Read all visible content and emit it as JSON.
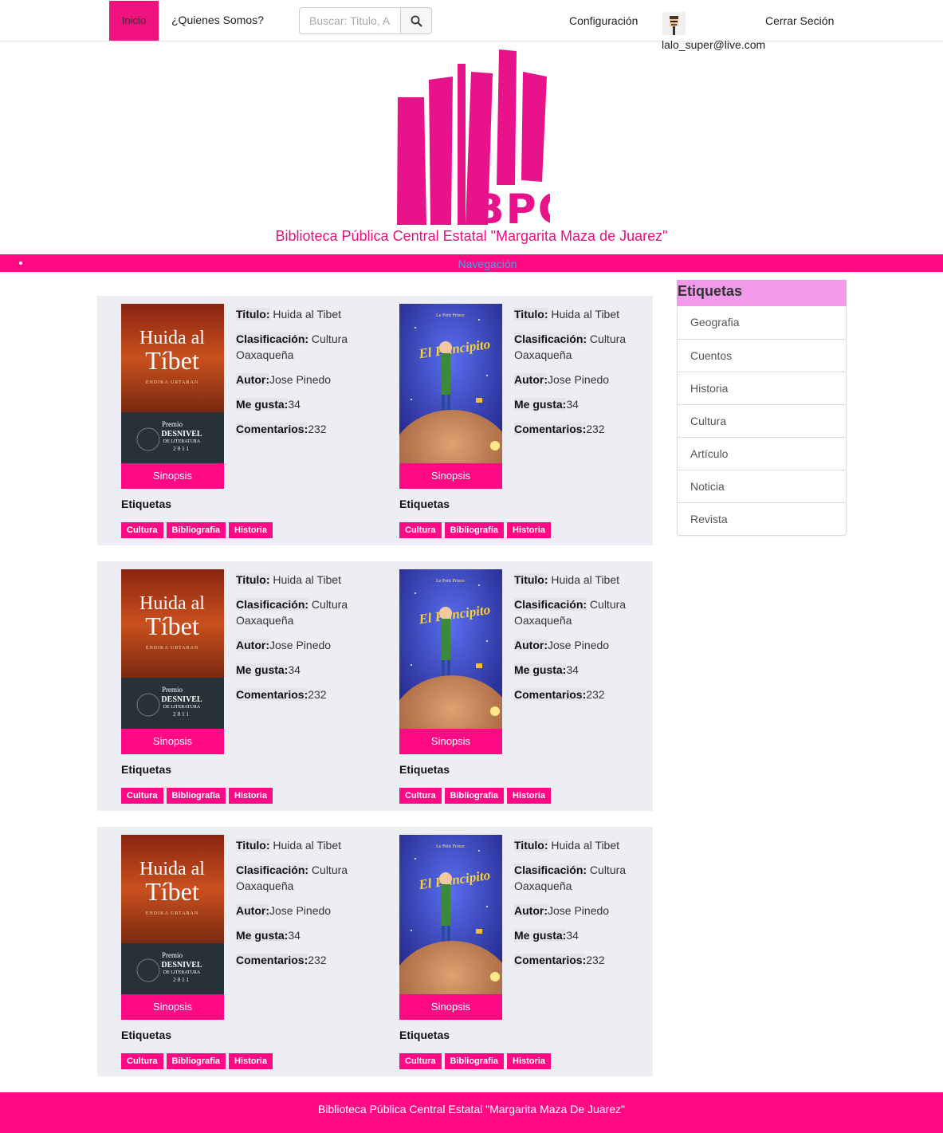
{
  "navbar": {
    "home_label": "Inicio",
    "about_label": "¿Quienes Somos?",
    "search_placeholder": "Buscar: Titulo, A",
    "config_label": "Configuración",
    "user_email": "lalo_super@live.com",
    "logout_label": "Cerrar Seción"
  },
  "header": {
    "logo_text": "BPC",
    "site_title": "Biblioteca Pública Central Estatal \"Margarita Maza de Juarez\"",
    "nav_label": "Navegación"
  },
  "colors": {
    "brand_pink": "#ff0a84",
    "logo_pink": "#e8128a",
    "sidebar_head": "#f09ae9",
    "panel_bg": "#eceef4"
  },
  "labels": {
    "title": "Titulo:",
    "classification": "Clasificación:",
    "author": "Autor:",
    "likes": "Me gusta:",
    "comments": "Comentarios:",
    "synopsis": "Sinopsis",
    "tags_heading": "Etiquetas"
  },
  "books": [
    {
      "title": "Huida al Tibet",
      "classification": "Cultura Oaxaqueña",
      "author": "Jose Pinedo",
      "likes": "34",
      "comments": "232",
      "cover": "huida-al-tibet",
      "tags": [
        "Cultura",
        "Bibliografia",
        "Historia"
      ]
    },
    {
      "title": "Huida al Tibet",
      "classification": "Cultura Oaxaqueña",
      "author": "Jose Pinedo",
      "likes": "34",
      "comments": "232",
      "cover": "el-principito",
      "tags": [
        "Cultura",
        "Bibliografia",
        "Historia"
      ]
    },
    {
      "title": "Huida al Tibet",
      "classification": "Cultura Oaxaqueña",
      "author": "Jose Pinedo",
      "likes": "34",
      "comments": "232",
      "cover": "huida-al-tibet",
      "tags": [
        "Cultura",
        "Bibliografia",
        "Historia"
      ]
    },
    {
      "title": "Huida al Tibet",
      "classification": "Cultura Oaxaqueña",
      "author": "Jose Pinedo",
      "likes": "34",
      "comments": "232",
      "cover": "el-principito",
      "tags": [
        "Cultura",
        "Bibliografia",
        "Historia"
      ]
    },
    {
      "title": "Huida al Tibet",
      "classification": "Cultura Oaxaqueña",
      "author": "Jose Pinedo",
      "likes": "34",
      "comments": "232",
      "cover": "huida-al-tibet",
      "tags": [
        "Cultura",
        "Bibliografia",
        "Historia"
      ]
    },
    {
      "title": "Huida al Tibet",
      "classification": "Cultura Oaxaqueña",
      "author": "Jose Pinedo",
      "likes": "34",
      "comments": "232",
      "cover": "el-principito",
      "tags": [
        "Cultura",
        "Bibliografia",
        "Historia"
      ]
    }
  ],
  "covers": {
    "huida": {
      "title_line1": "Huida al",
      "title_line2": "Tíbet",
      "author": "ENDIKA URTARAN",
      "prize_line1": "Premio",
      "prize_line2": "DESNIVEL",
      "prize_line3": "DE LITERATURA",
      "prize_year": "2011"
    },
    "principito": {
      "subtitle": "Le Petit Prince",
      "title": "El Principito"
    }
  },
  "sidebar": {
    "heading": "Etiquetas",
    "items": [
      "Geografia",
      "Cuentos",
      "Historia",
      "Cultura",
      "Artículo",
      "Noticia",
      "Revista"
    ]
  },
  "footer": {
    "text": "Biblioteca Pública Central Estatal \"Margarita Maza De Juarez\""
  }
}
